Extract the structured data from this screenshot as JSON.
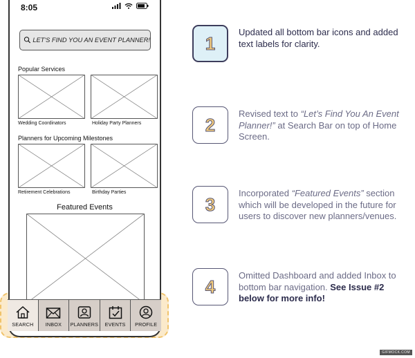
{
  "status": {
    "time": "8:05"
  },
  "search": {
    "placeholder": "LET'S FIND YOU AN EVENT PLANNER!"
  },
  "sections": {
    "popular": {
      "title": "Popular Services",
      "items": [
        "Wedding Coordinators",
        "Holiday Party Planners"
      ]
    },
    "milestones": {
      "title": "Planners for Upcoming Milestones",
      "items": [
        "Retirement Celebrations",
        "Birthday Parties"
      ]
    },
    "featured": {
      "title": "Featured Events"
    }
  },
  "nav": [
    {
      "label": "SEARCH",
      "icon": "home-icon",
      "active": true
    },
    {
      "label": "INBOX",
      "icon": "mail-icon"
    },
    {
      "label": "PLANNERS",
      "icon": "contacts-icon"
    },
    {
      "label": "EVENTS",
      "icon": "calendar-check-icon"
    },
    {
      "label": "PROFILE",
      "icon": "user-icon"
    }
  ],
  "notes": [
    {
      "num": "1",
      "text": "Updated all bottom bar icons and added text labels for clarity."
    },
    {
      "num": "2",
      "pre": "Revised text to ",
      "italic": "“Let’s Find You An Event Planner!”",
      "post": " at Search Bar on top of Home Screen."
    },
    {
      "num": "3",
      "pre": "Incorporated ",
      "italic": "“Featured Events”",
      "post": " section which will be developed in the future for users to discover new planners/venues."
    },
    {
      "num": "4",
      "text": "Omitted Dashboard and added Inbox to bottom bar navigation.",
      "bold": "See Issue #2 below for more info!"
    }
  ],
  "credit": "GIFMOCK.COM",
  "colors": {
    "accent_yellow": "#f2ca7c",
    "highlight_bg": "#fbeacb",
    "note_text": "#6b6b86",
    "note_dark": "#2c2c4c",
    "box_highlight": "#def0f7"
  }
}
